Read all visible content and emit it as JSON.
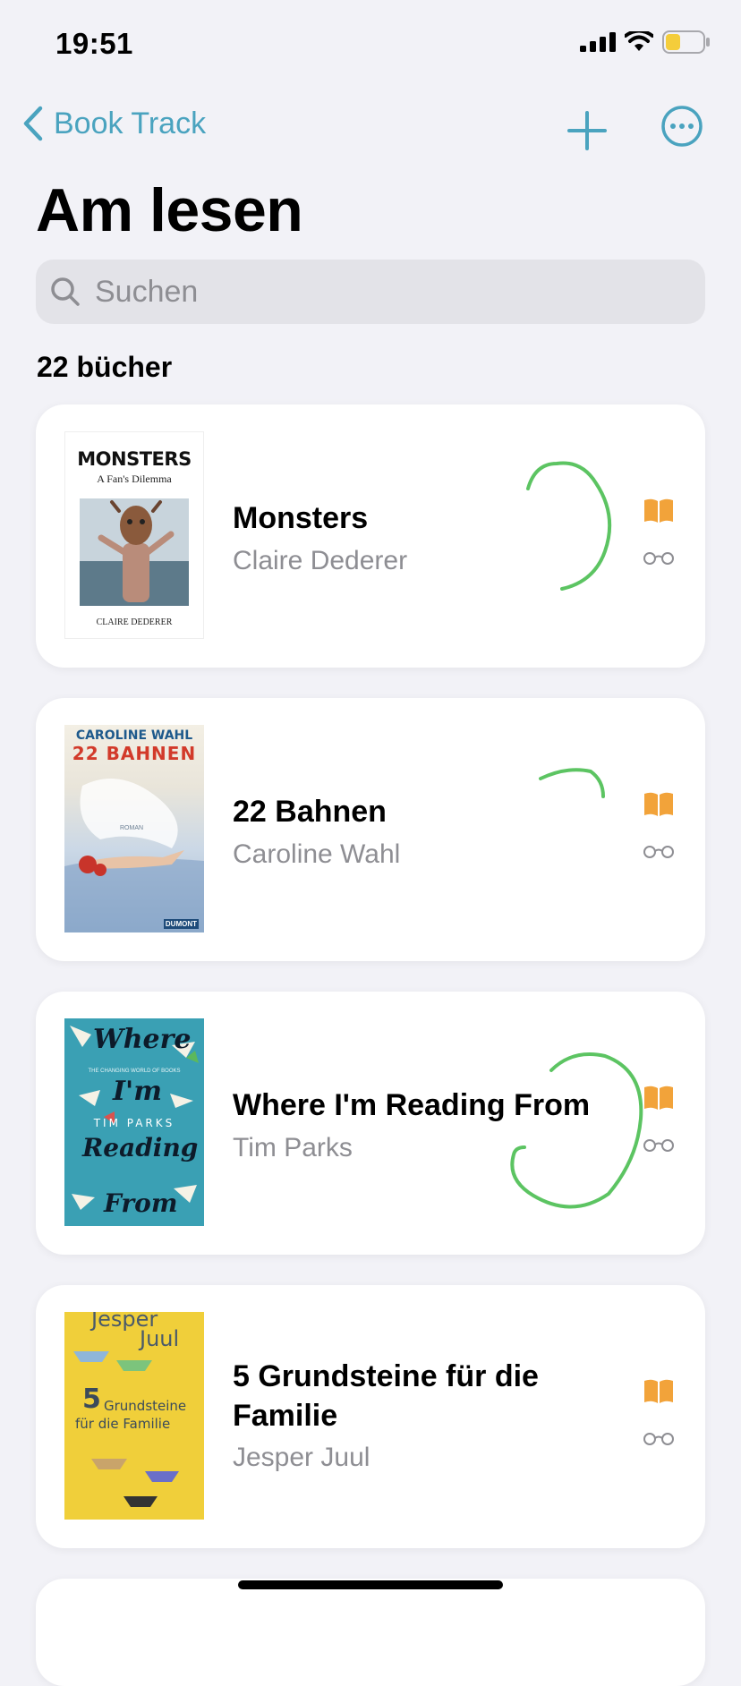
{
  "status_bar": {
    "time": "19:51"
  },
  "nav": {
    "back_label": "Book Track"
  },
  "page_title": "Am lesen",
  "search": {
    "placeholder": "Suchen"
  },
  "book_count": "22 bücher",
  "books": [
    {
      "title": "Monsters",
      "author": "Claire Dederer",
      "cover_text": [
        "MONSTERS",
        "A Fan's Dilemma",
        "CLAIRE DEDERER"
      ]
    },
    {
      "title": "22 Bahnen",
      "author": "Caroline Wahl",
      "cover_text": [
        "CAROLINE WAHL",
        "22 BAHNEN",
        "ROMAN",
        "DUMONT"
      ]
    },
    {
      "title": "Where I'm Reading From",
      "author": "Tim Parks",
      "cover_text": [
        "Where",
        "I'm",
        "TIM PARKS",
        "Reading",
        "From",
        "THE CHANGING WORLD OF BOOKS"
      ]
    },
    {
      "title": "5 Grundsteine für die Familie",
      "author": "Jesper Juul",
      "cover_text": [
        "Jesper",
        "Juul",
        "5",
        "Grundsteine",
        "für die Familie"
      ]
    }
  ],
  "colors": {
    "accent": "#4aa3bf",
    "orange": "#f2a33a",
    "scribble": "#5cc462",
    "card": "#ffffff",
    "background": "#f2f2f7"
  },
  "icons": [
    "signal-icon",
    "wifi-icon",
    "battery-icon",
    "chevron-left-icon",
    "plus-icon",
    "more-icon",
    "search-icon",
    "book-icon",
    "glasses-icon"
  ]
}
